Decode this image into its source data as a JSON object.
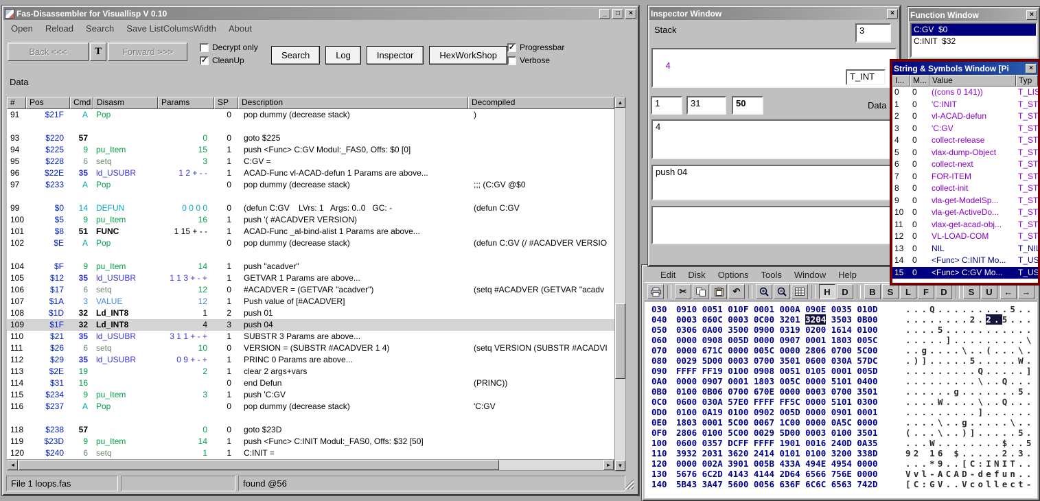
{
  "colors": {
    "titlebar_active": "#000080",
    "titlebar_inactive": "#7d7d7d",
    "selection_navy": "#000080",
    "symbols_border_red": "#7a0000",
    "pos_blue": "#0020cc",
    "green": "#00a048",
    "usubr_blue": "#2a2ae0",
    "defun_cyan": "#00a8cc",
    "value_purple": "#8a00c8",
    "hex_navy": "#000090"
  },
  "main": {
    "title": "Fas-Disassembler for Visuallisp V 0.10",
    "menu": [
      "Open",
      "Reload",
      "Search",
      "Save ListColumsWidth",
      "About"
    ],
    "toolbar": {
      "back": "Back <<<",
      "font_button": "T",
      "forward": "Forward >>>",
      "checkboxes": [
        {
          "label": "Decrypt only",
          "checked": false
        },
        {
          "label": "CleanUp",
          "checked": true
        },
        {
          "label": "Progressbar",
          "checked": true
        },
        {
          "label": "Verbose",
          "checked": false
        }
      ],
      "buttons": [
        "Search",
        "Log",
        "Inspector",
        "HexWorkShop"
      ]
    },
    "data_label": "Data",
    "table": {
      "columns": [
        "#",
        "Pos",
        "Cmd",
        "Disasm",
        "Params",
        "SP",
        "Description",
        "Decompiled"
      ],
      "rows": [
        {
          "n": "91",
          "pos": "$21F",
          "cmd": "A",
          "dis": "Pop",
          "par": "",
          "sp": "0",
          "desc": "pop dummy (decrease stack)",
          "dec": ")",
          "c": "pop"
        },
        {
          "c": "none"
        },
        {
          "n": "93",
          "pos": "$220",
          "cmd": "57",
          "dis": "",
          "par": "0",
          "sp": "0",
          "desc": "goto $225",
          "dec": "",
          "c": "goto"
        },
        {
          "n": "94",
          "pos": "$225",
          "cmd": "9",
          "dis": "pu_Item",
          "par": "15",
          "sp": "1",
          "desc": "push <Func> C:GV Modul:_FAS0, Offs: $0 [0]",
          "dec": "",
          "c": "push"
        },
        {
          "n": "95",
          "pos": "$228",
          "cmd": "6",
          "dis": "setq",
          "par": "3",
          "sp": "1",
          "desc": "C:GV =",
          "dec": "",
          "c": "setq"
        },
        {
          "n": "96",
          "pos": "$22E",
          "cmd": "35",
          "dis": "ld_USUBR",
          "par": "1 2 + - -",
          "sp": "1",
          "desc": "ACAD-Func vl-ACAD-defun 1 Params are above...",
          "dec": "",
          "c": "usubr"
        },
        {
          "n": "97",
          "pos": "$233",
          "cmd": "A",
          "dis": "Pop",
          "par": "",
          "sp": "0",
          "desc": "pop dummy (decrease stack)",
          "dec": ";;; (C:GV @$0",
          "c": "pop"
        },
        {
          "c": "none"
        },
        {
          "n": "99",
          "pos": "$0",
          "cmd": "14",
          "dis": "DEFUN",
          "par": "0 0 0 0",
          "sp": "0",
          "desc": "(defun C:GV    LVrs: 1   Args: 0..0   GC: -",
          "dec": "(defun C:GV",
          "c": "defun"
        },
        {
          "n": "100",
          "pos": "$5",
          "cmd": "9",
          "dis": "pu_Item",
          "par": "16",
          "sp": "1",
          "desc": "push '( #ACADVER VERSION)",
          "dec": "",
          "c": "push"
        },
        {
          "n": "101",
          "pos": "$8",
          "cmd": "51",
          "dis": "FUNC",
          "par": "1 15 + - -",
          "sp": "1",
          "desc": "ACAD-Func _al-bind-alist 1 Params are above...",
          "dec": "",
          "c": "func"
        },
        {
          "n": "102",
          "pos": "$E",
          "cmd": "A",
          "dis": "Pop",
          "par": "",
          "sp": "0",
          "desc": "pop dummy (decrease stack)",
          "dec": "(defun C:GV (/ #ACADVER VERSIO",
          "c": "pop"
        },
        {
          "c": "none"
        },
        {
          "n": "104",
          "pos": "$F",
          "cmd": "9",
          "dis": "pu_Item",
          "par": "14",
          "sp": "1",
          "desc": "push \"acadver\"",
          "dec": "",
          "c": "push"
        },
        {
          "n": "105",
          "pos": "$12",
          "cmd": "35",
          "dis": "ld_USUBR",
          "par": "1 1 3 + - +",
          "sp": "1",
          "desc": "GETVAR 1 Params are above...",
          "dec": "",
          "c": "usubr"
        },
        {
          "n": "106",
          "pos": "$17",
          "cmd": "6",
          "dis": "setq",
          "par": "12",
          "sp": "0",
          "desc": "#ACADVER = (GETVAR \"acadver\")",
          "dec": "(setq #ACADVER (GETVAR \"acadv",
          "c": "setq"
        },
        {
          "n": "107",
          "pos": "$1A",
          "cmd": "3",
          "dis": "VALUE",
          "par": "12",
          "sp": "1",
          "desc": "Push value of [#ACADVER]",
          "dec": "",
          "c": "value"
        },
        {
          "n": "108",
          "pos": "$1D",
          "cmd": "32",
          "dis": "Ld_INT8",
          "par": "1",
          "sp": "2",
          "desc": "push 01",
          "dec": "",
          "c": "int8"
        },
        {
          "n": "109",
          "pos": "$1F",
          "cmd": "32",
          "dis": "Ld_INT8",
          "par": "4",
          "sp": "3",
          "desc": "push 04",
          "dec": "",
          "c": "int8",
          "sel": true
        },
        {
          "n": "110",
          "pos": "$21",
          "cmd": "35",
          "dis": "ld_USUBR",
          "par": "3 1 1 + - +",
          "sp": "1",
          "desc": "SUBSTR 3 Params are above...",
          "dec": "",
          "c": "usubr"
        },
        {
          "n": "111",
          "pos": "$26",
          "cmd": "6",
          "dis": "setq",
          "par": "10",
          "sp": "0",
          "desc": "VERSION = (SUBSTR #ACADVER 1 4)",
          "dec": "(setq VERSION (SUBSTR #ACADVI",
          "c": "setq"
        },
        {
          "n": "112",
          "pos": "$29",
          "cmd": "35",
          "dis": "ld_USUBR",
          "par": "0 9 + - +",
          "sp": "1",
          "desc": "PRINC 0 Params are above...",
          "dec": "",
          "c": "usubr"
        },
        {
          "n": "113",
          "pos": "$2E",
          "cmd": "19",
          "dis": "",
          "par": "2",
          "sp": "1",
          "desc": "clear 2 args+vars",
          "dec": "",
          "c": "misc"
        },
        {
          "n": "114",
          "pos": "$31",
          "cmd": "16",
          "dis": "",
          "par": "",
          "sp": "0",
          "desc": "end Defun",
          "dec": "(PRINC))",
          "c": "misc"
        },
        {
          "n": "115",
          "pos": "$234",
          "cmd": "9",
          "dis": "pu_Item",
          "par": "3",
          "sp": "1",
          "desc": "push 'C:GV",
          "dec": "",
          "c": "push"
        },
        {
          "n": "116",
          "pos": "$237",
          "cmd": "A",
          "dis": "Pop",
          "par": "",
          "sp": "0",
          "desc": "pop dummy (decrease stack)",
          "dec": "'C:GV",
          "c": "pop"
        },
        {
          "c": "none"
        },
        {
          "n": "118",
          "pos": "$238",
          "cmd": "57",
          "dis": "",
          "par": "0",
          "sp": "0",
          "desc": "goto $23D",
          "dec": "",
          "c": "goto"
        },
        {
          "n": "119",
          "pos": "$23D",
          "cmd": "9",
          "dis": "pu_Item",
          "par": "14",
          "sp": "1",
          "desc": "push <Func> C:INIT Modul:_FAS0, Offs: $32 [50]",
          "dec": "",
          "c": "push"
        },
        {
          "n": "120",
          "pos": "$240",
          "cmd": "6",
          "dis": "setq",
          "par": "1",
          "sp": "1",
          "desc": "C:INIT =",
          "dec": "",
          "c": "setq"
        }
      ]
    },
    "statusbar": [
      "File 1 loops.fas",
      "",
      "found @56"
    ]
  },
  "inspector": {
    "title": "Inspector Window",
    "stack_label": "Stack",
    "stack_count": "3",
    "top_value": "4",
    "type_label": "T_INT",
    "fields": [
      "1",
      "31",
      "50"
    ],
    "data_label": "Data",
    "mid_value": "4",
    "code_value": "push 04"
  },
  "function_window": {
    "title": "Function Window",
    "items": [
      {
        "label": "C:GV  $0",
        "selected": true
      },
      {
        "label": "C:INIT  $32",
        "selected": false
      }
    ]
  },
  "symbols": {
    "title": "String & Symbols Window [Pi",
    "columns": [
      "I...",
      "M...",
      "Value",
      "Typ"
    ],
    "rows": [
      {
        "i": "0",
        "m": "0",
        "v": "((cons 0 141))",
        "t": "T_LIST",
        "vc": "p"
      },
      {
        "i": "1",
        "m": "0",
        "v": "'C:INIT",
        "t": "T_STR",
        "vc": "p"
      },
      {
        "i": "2",
        "m": "0",
        "v": "vl-ACAD-defun",
        "t": "T_STR",
        "vc": "p"
      },
      {
        "i": "3",
        "m": "0",
        "v": "'C:GV",
        "t": "T_STR",
        "vc": "p"
      },
      {
        "i": "4",
        "m": "0",
        "v": "collect-release",
        "t": "T_STR",
        "vc": "p"
      },
      {
        "i": "5",
        "m": "0",
        "v": "vlax-dump-Object",
        "t": "T_STR",
        "vc": "p"
      },
      {
        "i": "6",
        "m": "0",
        "v": "collect-next",
        "t": "T_STR",
        "vc": "p"
      },
      {
        "i": "7",
        "m": "0",
        "v": "FOR-ITEM",
        "t": "T_STR",
        "vc": "p"
      },
      {
        "i": "8",
        "m": "0",
        "v": "collect-init",
        "t": "T_STR",
        "vc": "p"
      },
      {
        "i": "9",
        "m": "0",
        "v": "vla-get-ModelSp...",
        "t": "T_STR",
        "vc": "p"
      },
      {
        "i": "10",
        "m": "0",
        "v": "vla-get-ActiveDo...",
        "t": "T_STR",
        "vc": "p"
      },
      {
        "i": "11",
        "m": "0",
        "v": "vlax-get-acad-obj...",
        "t": "T_STR",
        "vc": "p"
      },
      {
        "i": "12",
        "m": "0",
        "v": "VL-LOAD-COM",
        "t": "T_STR",
        "vc": "p"
      },
      {
        "i": "13",
        "m": "0",
        "v": "NIL",
        "t": "T_NIL",
        "vc": "d"
      },
      {
        "i": "14",
        "m": "0",
        "v": "<Func> C:INIT Mo...",
        "t": "T_USU",
        "vc": "d"
      },
      {
        "i": "15",
        "m": "0",
        "v": "<Func> C:GV Mo...",
        "t": "T_USU",
        "vc": "d",
        "sel": true
      }
    ]
  },
  "hex": {
    "menu": [
      "Edit",
      "Disk",
      "Options",
      "Tools",
      "Window",
      "Help"
    ],
    "toolbar": {
      "letters": [
        [
          "H",
          "D"
        ],
        [
          "B",
          "S",
          "L",
          "F",
          "D"
        ],
        [
          "S",
          "U"
        ]
      ],
      "pressed": "H",
      "arrows": [
        "←",
        "→"
      ]
    },
    "lines": [
      {
        "a": "030",
        "h": "0910 0051 010F 0001 000A 090E 0035 010D",
        "t": "...Q.........5.."
      },
      {
        "a": "040",
        "h1": "0003 060C 0003 0C00 3201 ",
        "hl": "3204",
        "h2": " 3503 0B00",
        "t1": "........2.",
        "thl": "2.",
        "t2": "5..."
      },
      {
        "a": "050",
        "h": "0306 0A00 3500 0900 0319 0200 1614 0100",
        "t": "....5..........."
      },
      {
        "a": "060",
        "h": "0000 0908 005D 0000 0907 0001 1803 005C",
        "t": ".....].........\\"
      },
      {
        "a": "070",
        "h": "0000 671C 0000 005C 0000 2806 0700 5C00",
        "t": "..g....\\..(...\\."
      },
      {
        "a": "080",
        "h": "0029 5D00 0003 0700 3501 0600 030A 57DC",
        "t": ".)].....5.....W."
      },
      {
        "a": "090",
        "h": "FFFF FF19 0100 0908 0051 0105 0001 005D",
        "t": ".........Q.....]"
      },
      {
        "a": "0A0",
        "h": "0000 0907 0001 1803 005C 0000 5101 0400",
        "t": ".........\\..Q..."
      },
      {
        "a": "0B0",
        "h": "0100 0B06 0700 670E 0000 0003 0700 3501",
        "t": "......g.......5."
      },
      {
        "a": "0C0",
        "h": "0600 030A 57E0 FFFF FF5C 0000 5101 0300",
        "t": "....W....\\..Q..."
      },
      {
        "a": "0D0",
        "h": "0100 0A19 0100 0902 005D 0000 0901 0001",
        "t": ".........]......"
      },
      {
        "a": "0E0",
        "h": "1803 0001 5C00 0067 1C00 0000 0A5C 0000",
        "t": "....\\..g.....\\.."
      },
      {
        "a": "0F0",
        "h": "2806 0100 5C00 0029 5D00 0003 0100 3501",
        "t": "(...\\..)].....5."
      },
      {
        "a": "100",
        "h": "0600 0357 DCFF FFFF 1901 0016 240D 0A35",
        "t": "...W........$..5"
      },
      {
        "a": "110",
        "h": "3932 2031 3620 2414 0101 0100 3200 338D",
        "t": "92 16 $.....2.3."
      },
      {
        "a": "120",
        "h": "0000 002A 3901 005B 433A 494E 4954 0000",
        "t": "...*9..[C:INIT.."
      },
      {
        "a": "130",
        "h": "5676 6C2D 4143 4144 2D64 6566 756E 0000",
        "t": "Vvl-ACAD-defun.."
      },
      {
        "a": "140",
        "h": "5B43 3A47 5600 0056 636F 6C6C 6563 742D",
        "t": "[C:GV..Vcollect-"
      }
    ]
  }
}
